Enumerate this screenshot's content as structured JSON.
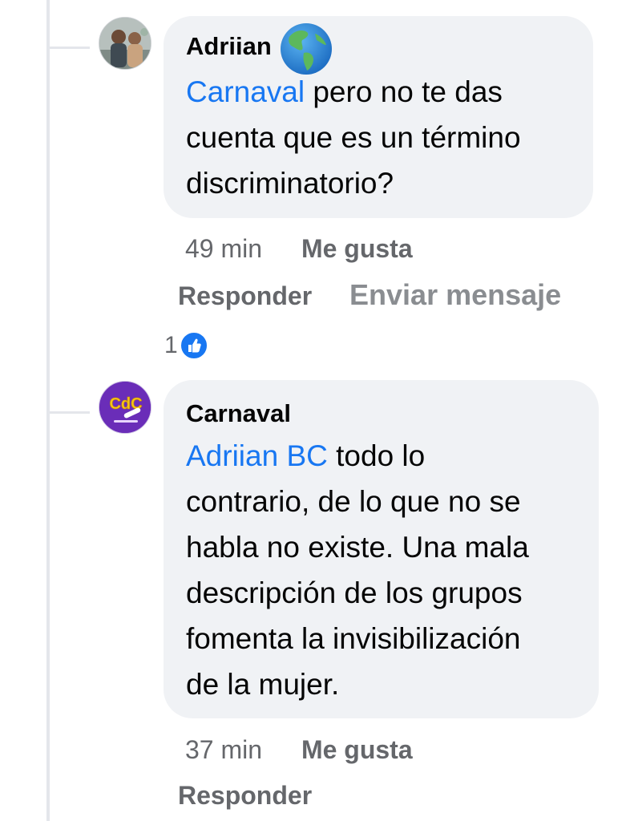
{
  "comments": [
    {
      "author": "Adriian",
      "author_badge_icon": "earth-globe-americas-icon",
      "mention": "Carnaval",
      "text_line1": " pero no te das",
      "text_line2": "cuenta que es un término",
      "text_line3": "discriminatorio?",
      "time": "49 min",
      "like_label": "Me gusta",
      "reply_label": "Responder",
      "message_label": "Enviar mensaje",
      "reaction_count": "1",
      "reaction_icon": "like-thumb-icon"
    },
    {
      "author": "Carnaval",
      "avatar_text": "CdC",
      "mention": "Adriian BC",
      "text_line1": " todo lo",
      "text_line2": "contrario, de lo que no se",
      "text_line3": "habla no existe. Una mala",
      "text_line4": "descripción de los grupos",
      "text_line5": "fomenta la invisibilización",
      "text_line6": "de la mujer.",
      "time": "37 min",
      "like_label": "Me gusta",
      "reply_label": "Responder"
    }
  ],
  "colors": {
    "mention": "#1877f2",
    "bubble": "#f0f2f5",
    "meta": "#65676b",
    "thread_line": "#e4e6eb"
  }
}
